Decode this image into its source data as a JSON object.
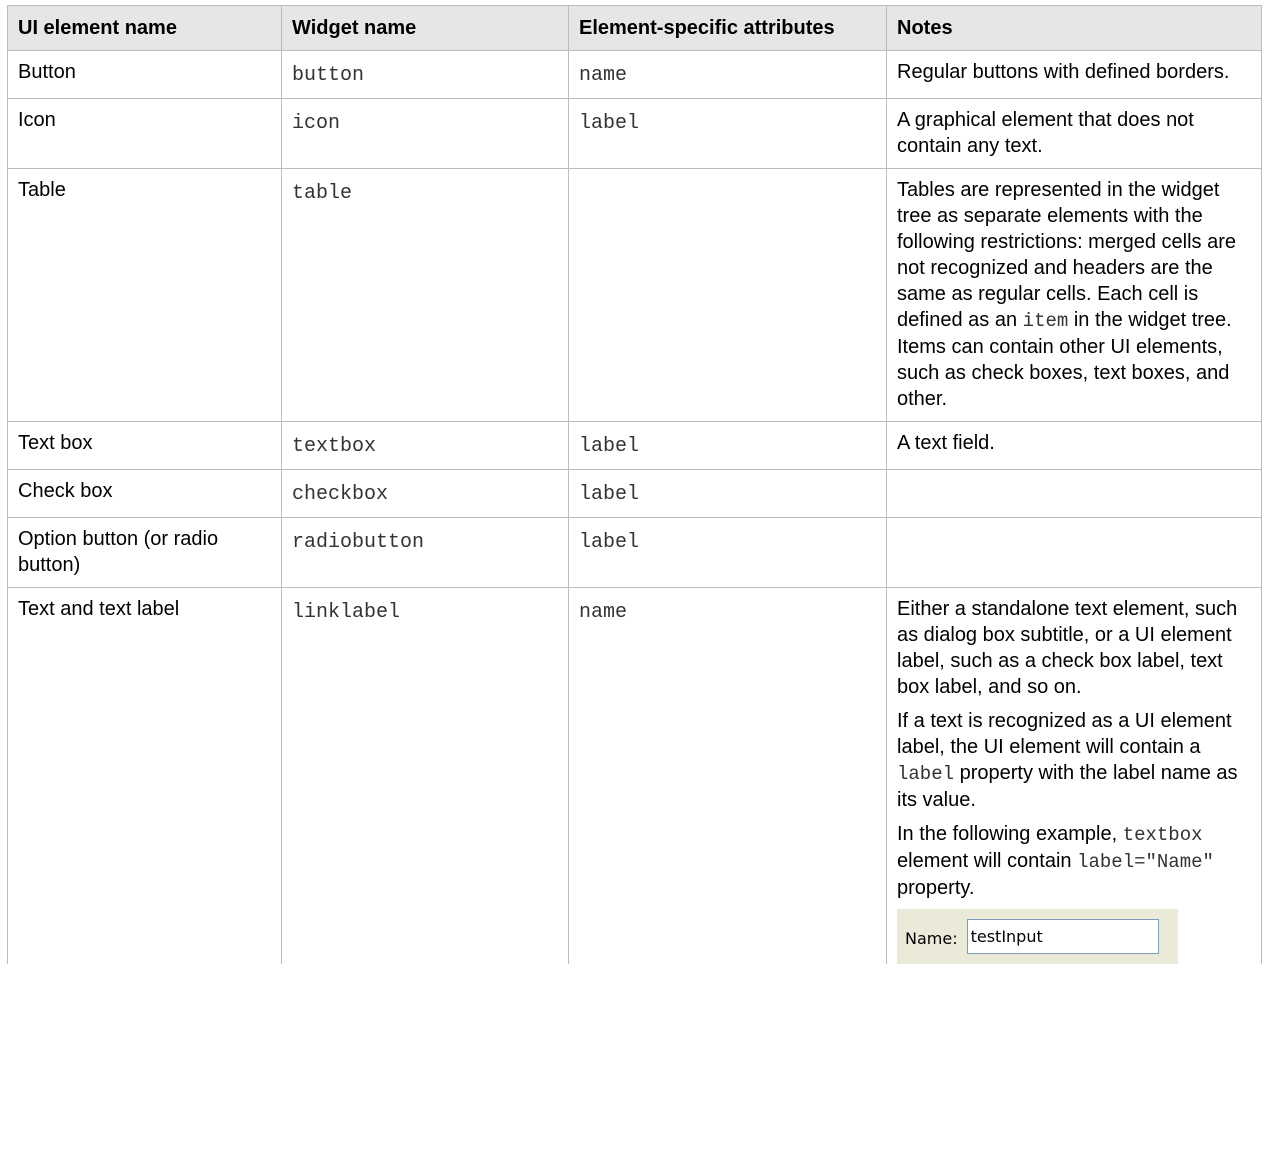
{
  "headers": {
    "ui_element": "UI element name",
    "widget": "Widget name",
    "attributes": "Element-specific attributes",
    "notes": "Notes"
  },
  "rows": [
    {
      "ui_element": "Button",
      "widget": "button",
      "attributes": "name",
      "notes": "Regular buttons with defined borders."
    },
    {
      "ui_element": "Icon",
      "widget": "icon",
      "attributes": "label",
      "notes": "A graphical element that does not contain any text."
    },
    {
      "ui_element": "Table",
      "widget": "table",
      "attributes": "",
      "notes_before": "Tables are represented in the widget tree as separate elements with the following restrictions: merged cells are not recognized and headers are the same as regular cells. Each cell is defined as an",
      "notes_code": "item",
      "notes_after": "in the widget tree. Items can contain other UI elements, such as check boxes, text boxes, and other."
    },
    {
      "ui_element": "Text box",
      "widget": "textbox",
      "attributes": "label",
      "notes": "A text field."
    },
    {
      "ui_element": "Check box",
      "widget": "checkbox",
      "attributes": "label",
      "notes": ""
    },
    {
      "ui_element": "Option button (or radio button)",
      "widget": "radiobutton",
      "attributes": "label",
      "notes": ""
    },
    {
      "ui_element": "Text and text label",
      "widget": "linklabel",
      "attributes": "name",
      "notes_p1": "Either a standalone text element, such as dialog box subtitle, or a UI element label, such as a check box label, text box label, and so on.",
      "notes_p2_before": "If a text is recognized as a UI element label, the UI element will contain a",
      "notes_p2_code": "label",
      "notes_p2_after": "property with the label name as its value.",
      "notes_p3": "In the following example,",
      "notes_p3_code1": "textbox",
      "notes_p3_mid": "element will contain",
      "notes_p3_code2": "label=\"Name\"",
      "notes_p3_after": "property.",
      "example_label": "Name:",
      "example_value": "testInput"
    }
  ]
}
